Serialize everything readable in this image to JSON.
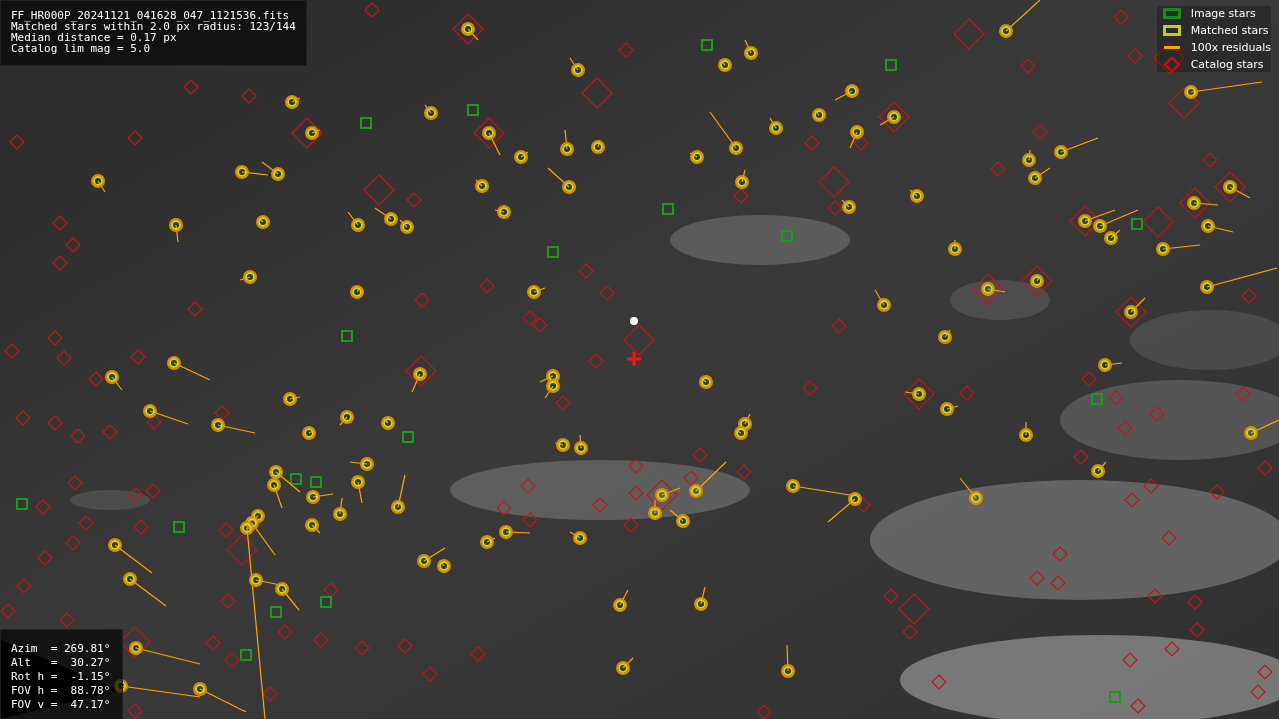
{
  "info_panel": {
    "lines": [
      "FF_HR000P_20241121_041628_047_1121536.fits",
      "Matched stars within 2.0 px radius: 123/144",
      "Median distance = 0.17 px",
      "Catalog lim mag = 5.0"
    ]
  },
  "legend": [
    {
      "label": "Image stars",
      "color": "#1a8a1a"
    },
    {
      "kind": "matched",
      "label": "Matched stars",
      "color": "#c8c81e"
    },
    {
      "kind": "residual",
      "label": "100x residuals",
      "color": "#ffa500"
    },
    {
      "kind": "catalog",
      "label": "Catalog stars",
      "color": "#b01010"
    }
  ],
  "pointing_panel": {
    "lines": [
      "Azim  = 269.81°",
      "Alt   =  30.27°",
      "Rot h =  -1.15°",
      "FOV h =  88.78°",
      "FOV v =  47.17°"
    ]
  }
}
